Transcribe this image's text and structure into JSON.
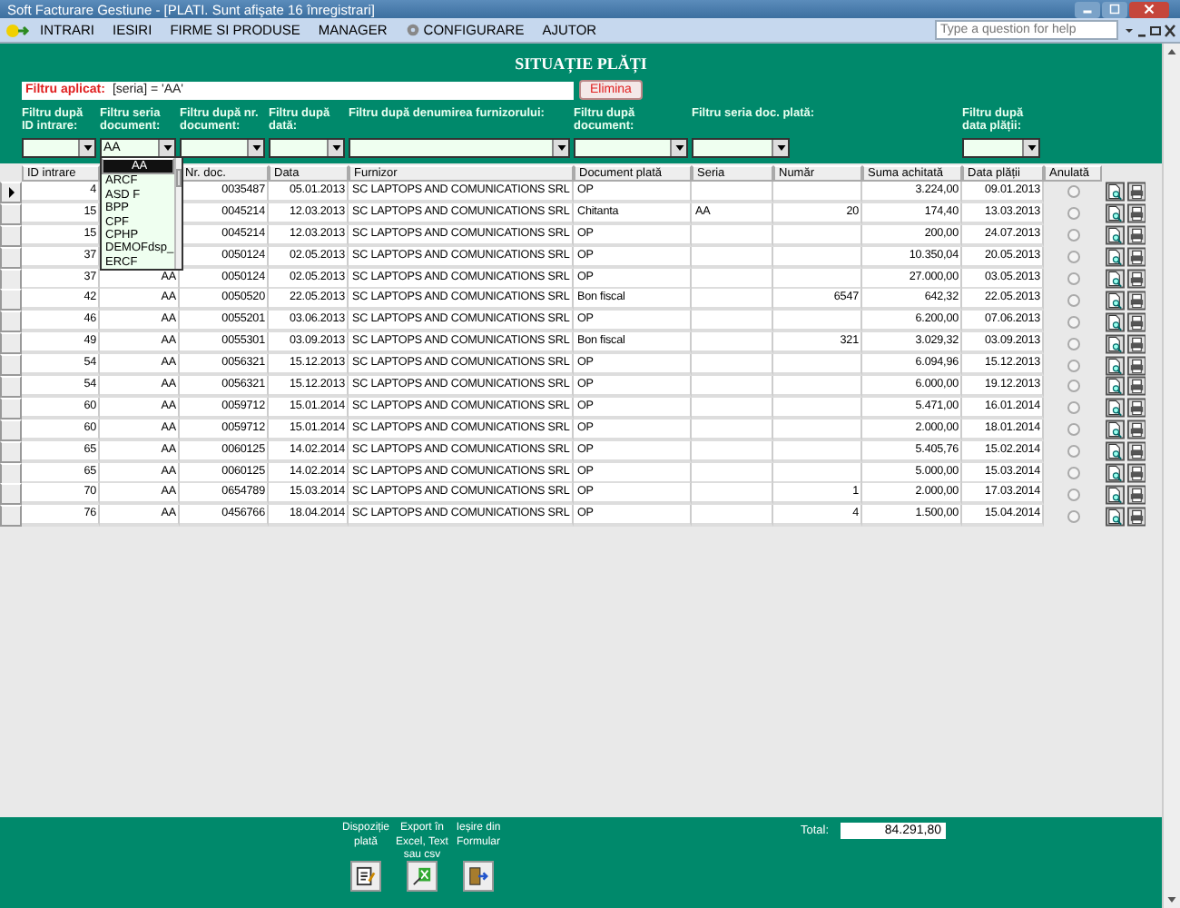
{
  "window": {
    "title": "Soft Facturare Gestiune - [PLATI. Sunt afişate 16 înregistrari]"
  },
  "menu": [
    "INTRARI",
    "IESIRI",
    "FIRME SI PRODUSE",
    "MANAGER",
    "CONFIGURARE",
    "AJUTOR"
  ],
  "help_box": {
    "placeholder": "Type a question for help"
  },
  "form_title": "SITUAȚIE PLĂȚI",
  "applied_filter": {
    "label": "Filtru aplicat:",
    "value": "[seria] = 'AA'",
    "button": "Elimina"
  },
  "filters": [
    {
      "label": "Filtru după ID intrare:"
    },
    {
      "label": "Filtru seria document:",
      "value": "AA",
      "expanded": true,
      "options": [
        {
          "text": "AA",
          "selected": true
        },
        {
          "text": "ARCF",
          "selected": false
        },
        {
          "text": "ASD F",
          "selected": false
        },
        {
          "text": "BPP",
          "selected": false
        },
        {
          "text": "CPF",
          "selected": false
        },
        {
          "text": "CPHP",
          "selected": false
        },
        {
          "text": "DEMOFdsp_",
          "selected": false
        },
        {
          "text": "ERCF",
          "selected": false
        }
      ]
    },
    {
      "label": "Filtru după nr. document:"
    },
    {
      "label": "Filtru după dată:"
    },
    {
      "label": "Filtru după denumirea furnizorului:"
    },
    {
      "label": "Filtru după document:"
    },
    {
      "label": "Filtru seria doc. plată:"
    },
    {
      "label": "Filtru după data plății:"
    }
  ],
  "table": {
    "columns": [
      "ID intrare",
      "Nr. doc.",
      "Data",
      "Furnizor",
      "Document plată",
      "Seria",
      "Număr",
      "Suma achitată",
      "Data plății",
      "Anulată"
    ],
    "rows": [
      {
        "current": true,
        "id": "4",
        "doc_nr": "0035487",
        "date": "05.01.2013",
        "supplier": "SC LAPTOPS AND COMUNICATIONS SRL",
        "payment_doc": "OP",
        "amount": "3.224,00",
        "payment_date": "09.01.2013",
        "cancelled": false
      },
      {
        "current": false,
        "id": "15",
        "doc_nr": "0045214",
        "date": "12.03.2013",
        "supplier": "SC LAPTOPS AND COMUNICATIONS SRL",
        "payment_doc": "Chitanta",
        "payment_series": "AA",
        "number": "20",
        "amount": "174,40",
        "payment_date": "13.03.2013",
        "cancelled": false
      },
      {
        "current": false,
        "id": "15",
        "doc_nr": "0045214",
        "date": "12.03.2013",
        "supplier": "SC LAPTOPS AND COMUNICATIONS SRL",
        "payment_doc": "OP",
        "amount": "200,00",
        "payment_date": "24.07.2013",
        "cancelled": false
      },
      {
        "current": false,
        "id": "37",
        "doc_nr": "0050124",
        "date": "02.05.2013",
        "supplier": "SC LAPTOPS AND COMUNICATIONS SRL",
        "payment_doc": "OP",
        "amount": "10.350,04",
        "payment_date": "20.05.2013",
        "cancelled": false
      },
      {
        "current": false,
        "id": "37",
        "series": "AA",
        "doc_nr": "0050124",
        "date": "02.05.2013",
        "supplier": "SC LAPTOPS AND COMUNICATIONS SRL",
        "payment_doc": "OP",
        "amount": "27.000,00",
        "payment_date": "03.05.2013",
        "cancelled": false
      },
      {
        "current": false,
        "id": "42",
        "series": "AA",
        "doc_nr": "0050520",
        "date": "22.05.2013",
        "supplier": "SC LAPTOPS AND COMUNICATIONS SRL",
        "payment_doc": "Bon fiscal",
        "number": "6547",
        "amount": "642,32",
        "payment_date": "22.05.2013",
        "cancelled": false
      },
      {
        "current": false,
        "id": "46",
        "series": "AA",
        "doc_nr": "0055201",
        "date": "03.06.2013",
        "supplier": "SC LAPTOPS AND COMUNICATIONS SRL",
        "payment_doc": "OP",
        "amount": "6.200,00",
        "payment_date": "07.06.2013",
        "cancelled": false
      },
      {
        "current": false,
        "id": "49",
        "series": "AA",
        "doc_nr": "0055301",
        "date": "03.09.2013",
        "supplier": "SC LAPTOPS AND COMUNICATIONS SRL",
        "payment_doc": "Bon fiscal",
        "number": "321",
        "amount": "3.029,32",
        "payment_date": "03.09.2013",
        "cancelled": false
      },
      {
        "current": false,
        "id": "54",
        "series": "AA",
        "doc_nr": "0056321",
        "date": "15.12.2013",
        "supplier": "SC LAPTOPS AND COMUNICATIONS SRL",
        "payment_doc": "OP",
        "amount": "6.094,96",
        "payment_date": "15.12.2013",
        "cancelled": false
      },
      {
        "current": false,
        "id": "54",
        "series": "AA",
        "doc_nr": "0056321",
        "date": "15.12.2013",
        "supplier": "SC LAPTOPS AND COMUNICATIONS SRL",
        "payment_doc": "OP",
        "amount": "6.000,00",
        "payment_date": "19.12.2013",
        "cancelled": false
      },
      {
        "current": false,
        "id": "60",
        "series": "AA",
        "doc_nr": "0059712",
        "date": "15.01.2014",
        "supplier": "SC LAPTOPS AND COMUNICATIONS SRL",
        "payment_doc": "OP",
        "amount": "5.471,00",
        "payment_date": "16.01.2014",
        "cancelled": false
      },
      {
        "current": false,
        "id": "60",
        "series": "AA",
        "doc_nr": "0059712",
        "date": "15.01.2014",
        "supplier": "SC LAPTOPS AND COMUNICATIONS SRL",
        "payment_doc": "OP",
        "amount": "2.000,00",
        "payment_date": "18.01.2014",
        "cancelled": false
      },
      {
        "current": false,
        "id": "65",
        "series": "AA",
        "doc_nr": "0060125",
        "date": "14.02.2014",
        "supplier": "SC LAPTOPS AND COMUNICATIONS SRL",
        "payment_doc": "OP",
        "amount": "5.405,76",
        "payment_date": "15.02.2014",
        "cancelled": false
      },
      {
        "current": false,
        "id": "65",
        "series": "AA",
        "doc_nr": "0060125",
        "date": "14.02.2014",
        "supplier": "SC LAPTOPS AND COMUNICATIONS SRL",
        "payment_doc": "OP",
        "amount": "5.000,00",
        "payment_date": "15.03.2014",
        "cancelled": false
      },
      {
        "current": false,
        "id": "70",
        "series": "AA",
        "doc_nr": "0654789",
        "date": "15.03.2014",
        "supplier": "SC LAPTOPS AND COMUNICATIONS SRL",
        "payment_doc": "OP",
        "number": "1",
        "amount": "2.000,00",
        "payment_date": "17.03.2014",
        "cancelled": false
      },
      {
        "current": false,
        "id": "76",
        "series": "AA",
        "doc_nr": "0456766",
        "date": "18.04.2014",
        "supplier": "SC LAPTOPS AND COMUNICATIONS SRL",
        "payment_doc": "OP",
        "number": "4",
        "amount": "1.500,00",
        "payment_date": "15.04.2014",
        "cancelled": false
      }
    ]
  },
  "footer": {
    "buttons": [
      {
        "kind": "order",
        "label": "Dispoziție plată"
      },
      {
        "kind": "export",
        "label": "Export în Excel, Text sau csv"
      },
      {
        "kind": "exit",
        "label": "Ieșire din Formular"
      }
    ],
    "total_label": "Total:",
    "total_value": "84.291,80"
  }
}
